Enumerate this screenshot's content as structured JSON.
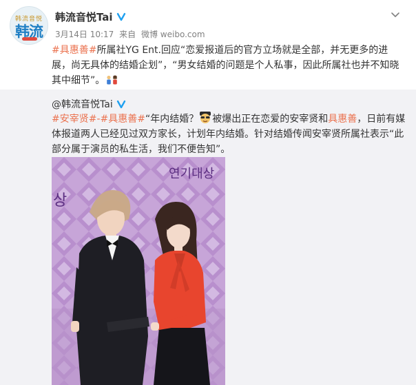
{
  "post": {
    "username": "韩流音悦Tai",
    "date": "3月14日 10:17",
    "source_prefix": "来自",
    "source": "微博 weibo.com",
    "text": {
      "topic": "#具惠善#",
      "body": "所属社YG Ent.回应“恋爱报道后的官方立场就是全部，并无更多的进展，尚无具体的结婚企划”，“男女结婚的问题是个人私事，因此所属社也并不知晓其中细节”。"
    }
  },
  "avatar": {
    "top_text": "韩流音悦",
    "main_text": "韩流"
  },
  "repost": {
    "author": "@韩流音悦Tai",
    "topic1": "#安宰贤#",
    "sep": "-",
    "topic2": "#具惠善#",
    "part1": "“年内结婚？",
    "part2": "被爆出正在恋爱的安宰贤和",
    "name_link": "具惠善",
    "part3": "，日前有媒体报道两人已经见过双方家长，计划年内结婚。针对结婚传闻安宰贤所属社表示“此部分属于演员的私生活，我们不便告知”。"
  },
  "photo": {
    "backdrop_text_1": "연기대상",
    "backdrop_text_2": "상"
  },
  "colors": {
    "link": "#eb7350",
    "verified": "#1ea0f0",
    "repost_bg": "#f2f2f5"
  },
  "icons": {
    "verified": "verified-v-icon",
    "more": "chevron-down-icon"
  }
}
